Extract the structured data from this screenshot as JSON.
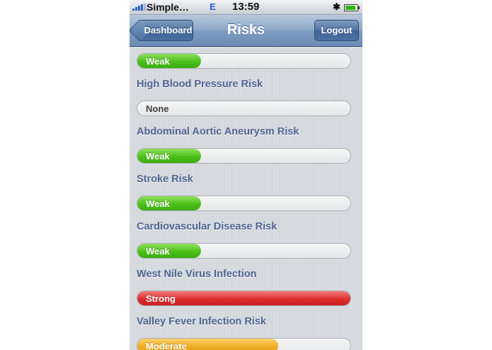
{
  "status_bar": {
    "carrier": "Simple…",
    "network": "E",
    "time": "13:59",
    "bluetooth_icon": "bluetooth-icon",
    "battery_icon": "battery-icon"
  },
  "nav": {
    "back_label": "Dashboard",
    "title": "Risks",
    "logout_label": "Logout"
  },
  "colors": {
    "weak": "#4cbf1c",
    "strong": "#dd3030",
    "moderate": "#f0ad23",
    "none": "#e6e7e9",
    "label": "#4f6490"
  },
  "risks": [
    {
      "name": "",
      "level": "Weak",
      "fill": 0.3
    },
    {
      "name": "High Blood Pressure Risk",
      "level": "None",
      "fill": 0
    },
    {
      "name": "Abdominal Aortic Aneurysm Risk",
      "level": "Weak",
      "fill": 0.3
    },
    {
      "name": "Stroke Risk",
      "level": "Weak",
      "fill": 0.3
    },
    {
      "name": "Cardiovascular Disease Risk",
      "level": "Weak",
      "fill": 0.3
    },
    {
      "name": "West Nile Virus Infection",
      "level": "Strong",
      "fill": 1.0
    },
    {
      "name": "Valley Fever Infection Risk",
      "level": "Moderate",
      "fill": 0.66
    }
  ]
}
